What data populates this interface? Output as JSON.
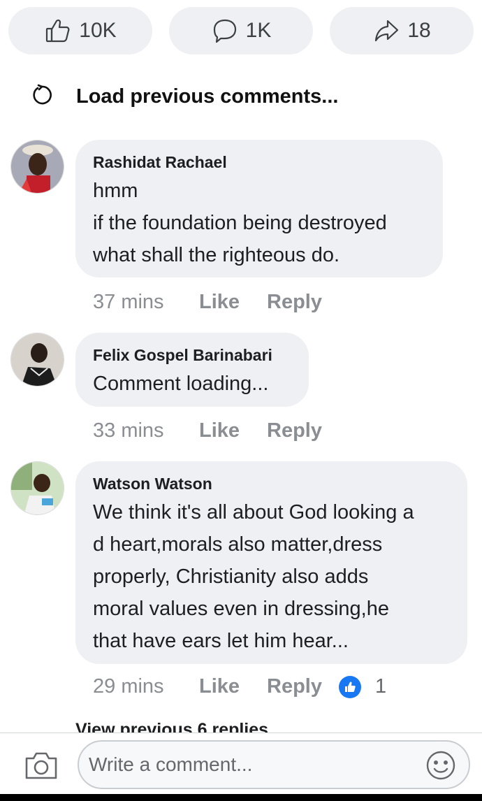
{
  "reactions": {
    "likes": "10K",
    "comments": "1K",
    "shares": "18"
  },
  "load_previous": "Load previous comments...",
  "comments": [
    {
      "author": "Rashidat Rachael",
      "lines": [
        "hmm",
        "if the foundation being destroyed",
        "what shall the righteous do."
      ],
      "time": "37 mins",
      "like": "Like",
      "reply": "Reply"
    },
    {
      "author": "Felix Gospel Barinabari",
      "lines": [
        "Comment loading..."
      ],
      "time": "33 mins",
      "like": "Like",
      "reply": "Reply"
    },
    {
      "author": "Watson Watson",
      "lines": [
        "We think it's all about God looking a",
        "d heart,morals also matter,dress",
        "properly, Christianity also adds",
        "moral values even in dressing,he",
        "that have ears let him hear..."
      ],
      "time": "29 mins",
      "like": "Like",
      "reply": "Reply",
      "reaction_count": "1"
    }
  ],
  "view_previous_replies": "View previous 6 replies",
  "composer": {
    "placeholder": "Write a comment..."
  },
  "icons": {
    "like": "thumbs-up-icon",
    "comment": "speech-bubble-icon",
    "share": "share-arrow-icon",
    "reload": "reload-icon",
    "camera": "camera-icon",
    "emoji": "smiley-icon"
  },
  "colors": {
    "bubble": "#eef0f3",
    "meta": "#8a8d91",
    "accent": "#1877f2"
  }
}
